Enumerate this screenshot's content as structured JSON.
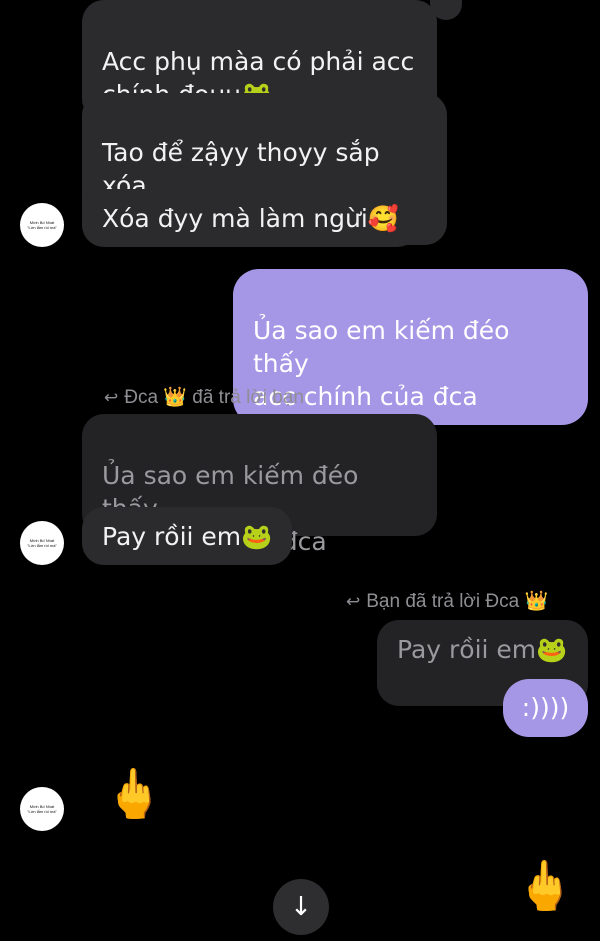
{
  "messages": {
    "m1": "Acc phụ màa có phải acc\nchính đouu🐸",
    "m2": "Tao để zậyy thoyy sắp xóa\nrồii",
    "m3": "Xóa đyy mà làm ngừi🥰",
    "m4": "Ủa sao em kiếm đéo thấy\nacc chính của đca",
    "reply_label_1": "Đca 👑 đã trả lời bạn",
    "quoted_1": "Ủa sao em kiếm đéo thấy\nacc chính của đca",
    "m5": "Pay rồii em🐸",
    "reply_label_2": "Bạn đã trả lời Đca 👑",
    "quoted_2": "Pay rồii em🐸",
    "m6": ":))))",
    "m7": "🖕",
    "m8": "🖕"
  },
  "avatar": {
    "text": "Mình Bố Nhát\n\"Lớn lắm rồi mà\""
  },
  "icons": {
    "reply": "reply-arrow-icon",
    "scroll": "arrow-down-icon"
  },
  "colors": {
    "background": "#000000",
    "incoming": "#2b2b2d",
    "outgoing": "#a596e6"
  }
}
